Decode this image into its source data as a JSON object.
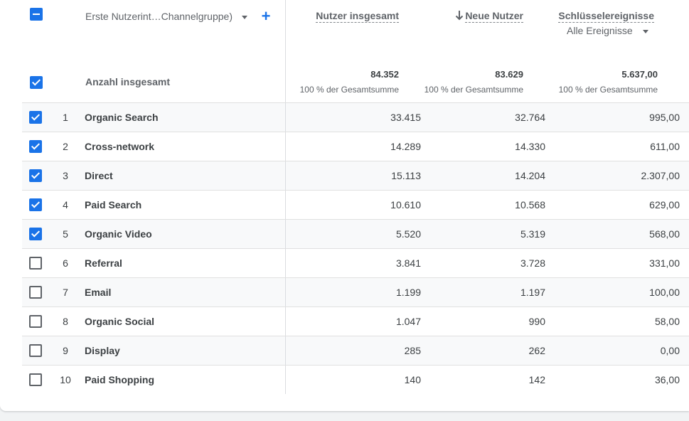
{
  "header": {
    "dimension_label": "Erste Nutzerint…Channelgruppe)",
    "metrics": [
      {
        "label": "Nutzer insgesamt",
        "sorted": false
      },
      {
        "label": "Neue Nutzer",
        "sorted": true,
        "sort_direction": "descending"
      },
      {
        "label": "Schlüsselereignisse",
        "sorted": false
      }
    ],
    "event_filter": "Alle Ereignisse",
    "select_all_state": "indeterminate"
  },
  "totals": {
    "label": "Anzahl insgesamt",
    "checked": true,
    "values": [
      "84.352",
      "83.629",
      "5.637,00"
    ],
    "subtexts": [
      "100 % der Gesamtsumme",
      "100 % der Gesamtsumme",
      "100 % der Gesamtsumme"
    ]
  },
  "rows": [
    {
      "index": "1",
      "name": "Organic Search",
      "checked": true,
      "users": "33.415",
      "new_users": "32.764",
      "key_events": "995,00"
    },
    {
      "index": "2",
      "name": "Cross-network",
      "checked": true,
      "users": "14.289",
      "new_users": "14.330",
      "key_events": "611,00"
    },
    {
      "index": "3",
      "name": "Direct",
      "checked": true,
      "users": "15.113",
      "new_users": "14.204",
      "key_events": "2.307,00"
    },
    {
      "index": "4",
      "name": "Paid Search",
      "checked": true,
      "users": "10.610",
      "new_users": "10.568",
      "key_events": "629,00"
    },
    {
      "index": "5",
      "name": "Organic Video",
      "checked": true,
      "users": "5.520",
      "new_users": "5.319",
      "key_events": "568,00"
    },
    {
      "index": "6",
      "name": "Referral",
      "checked": false,
      "users": "3.841",
      "new_users": "3.728",
      "key_events": "331,00"
    },
    {
      "index": "7",
      "name": "Email",
      "checked": false,
      "users": "1.199",
      "new_users": "1.197",
      "key_events": "100,00"
    },
    {
      "index": "8",
      "name": "Organic Social",
      "checked": false,
      "users": "1.047",
      "new_users": "990",
      "key_events": "58,00"
    },
    {
      "index": "9",
      "name": "Display",
      "checked": false,
      "users": "285",
      "new_users": "262",
      "key_events": "0,00"
    },
    {
      "index": "10",
      "name": "Paid Shopping",
      "checked": false,
      "users": "140",
      "new_users": "142",
      "key_events": "36,00"
    }
  ],
  "colors": {
    "accent": "#1a73e8",
    "text": "#3c4043",
    "muted": "#5f6368",
    "row_alt": "#f8f9fa",
    "divider": "#dadce0"
  },
  "icons": [
    "checkbox-indeterminate-icon",
    "dropdown-arrow-icon",
    "add-icon",
    "arrow-down-icon",
    "checkbox-checked-icon",
    "checkbox-unchecked-icon"
  ]
}
